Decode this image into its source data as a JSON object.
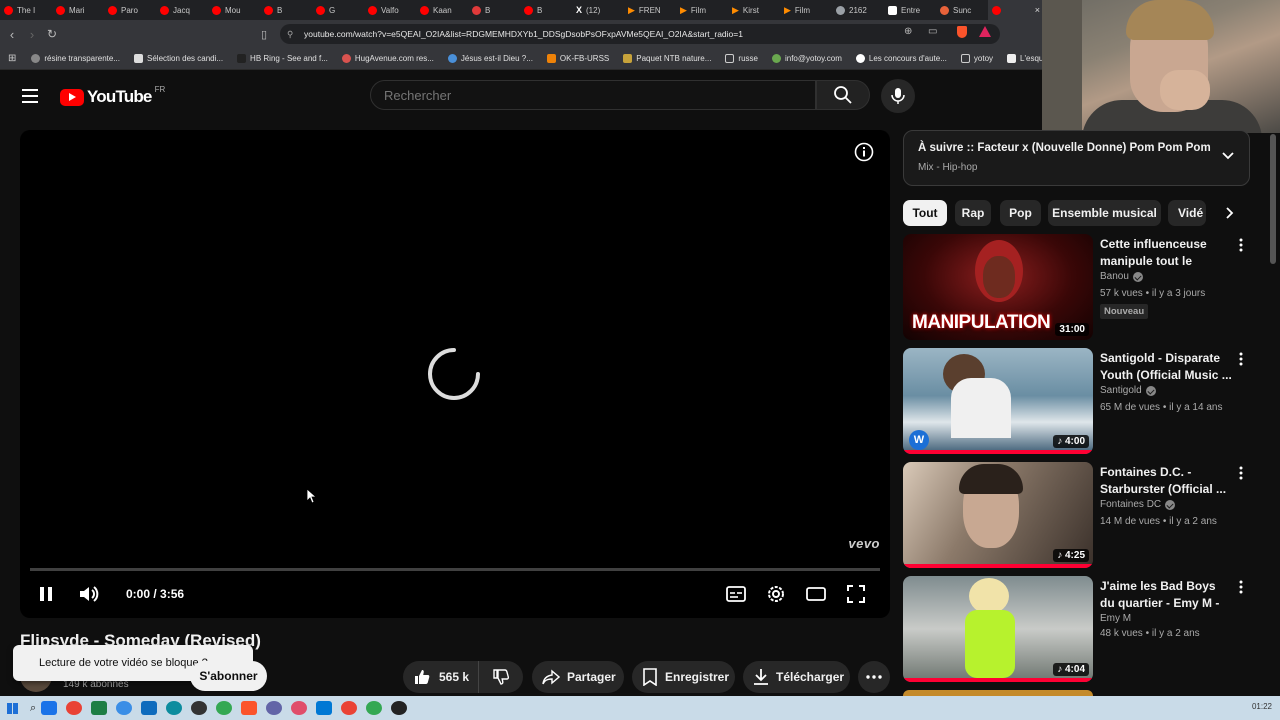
{
  "browser": {
    "tabs": [
      {
        "label": "The I",
        "color": "#ff0000"
      },
      {
        "label": "Mari",
        "color": "#ff0000"
      },
      {
        "label": "Paro",
        "color": "#ff0000"
      },
      {
        "label": "Jacq",
        "color": "#ff0000"
      },
      {
        "label": "Mou",
        "color": "#ff0000"
      },
      {
        "label": "B",
        "color": "#ff0000"
      },
      {
        "label": "G",
        "color": "#ff0000"
      },
      {
        "label": "Valfo",
        "color": "#ff0000"
      },
      {
        "label": "Kaan",
        "color": "#ff0000"
      },
      {
        "label": "B",
        "color": "#e03a3a"
      },
      {
        "label": "B",
        "color": "#ff0000"
      },
      {
        "label": "(12)",
        "color": "#ffffff"
      },
      {
        "label": "FREN",
        "color": "#ff8c00"
      },
      {
        "label": "Film",
        "color": "#ff8c00"
      },
      {
        "label": "Kirst",
        "color": "#ff8c00"
      },
      {
        "label": "Film",
        "color": "#ff8c00"
      },
      {
        "label": "2162",
        "color": "#9aa0a6"
      },
      {
        "label": "Entre",
        "color": "#ffffff"
      },
      {
        "label": "Sunc",
        "color": "#e8623a"
      }
    ],
    "active_tab_close": "×",
    "url": "youtube.com/watch?v=e5QEAI_O2IA&list=RDGMEMHDXYb1_DDSgDsobPsOFxpAVMe5QEAI_O2IA&start_radio=1",
    "bookmarks": [
      "résine transparente...",
      "Sélection des candi...",
      "HB Ring - See and f...",
      "HugAvenue.com res...",
      "Jésus est-il Dieu ?...",
      "OK-FB-URSS",
      "Paquet NTB nature...",
      "russe",
      "info@yotoy.com",
      "Les concours d'aute...",
      "yotoy",
      "L'esqu"
    ]
  },
  "header": {
    "logo_text": "YouTube",
    "logo_region": "FR",
    "search_placeholder": "Rechercher"
  },
  "player": {
    "time": "0:00 / 3:56",
    "watermark": "vevo",
    "progress": 0
  },
  "video": {
    "title": "Flipsyde - Someday (Revised)",
    "subscribers": "149 k abonnés",
    "toast": "Lecture de votre vidéo se bloque ?",
    "subscribe_label": "S'abonner",
    "likes": "565 k",
    "share_label": "Partager",
    "save_label": "Enregistrer",
    "download_label": "Télécharger"
  },
  "upnext": {
    "title": "À suivre :: Facteur x (Nouvelle Donne) Pom Pom Pom",
    "subtitle": "Mix - Hip-hop"
  },
  "chips": [
    "Tout",
    "Rap",
    "Pop",
    "Ensemble musical",
    "Vidé"
  ],
  "recommendations": [
    {
      "title": "Cette influenceuse manipule tout le mond...",
      "channel": "Banou",
      "meta": "57 k vues • il y a 3 jours",
      "badge": "Nouveau",
      "duration": "31:00",
      "thumb_text": "MANIPULATION"
    },
    {
      "title": "Santigold - Disparate Youth (Official Music ...",
      "channel": "Santigold",
      "meta": "65 M de vues • il y a 14 ans",
      "duration": "4:00"
    },
    {
      "title": "Fontaines D.C. - Starburster (Official ...",
      "channel": "Fontaines DC",
      "meta": "14 M de vues • il y a 2 ans",
      "duration": "4:25"
    },
    {
      "title": "J'aime les Bad Boys du quartier - Emy M - (Clip...",
      "channel": "Emy M",
      "meta": "48 k vues • il y a 2 ans",
      "duration": "4:04"
    }
  ],
  "taskbar": {
    "clock": "01:22"
  }
}
